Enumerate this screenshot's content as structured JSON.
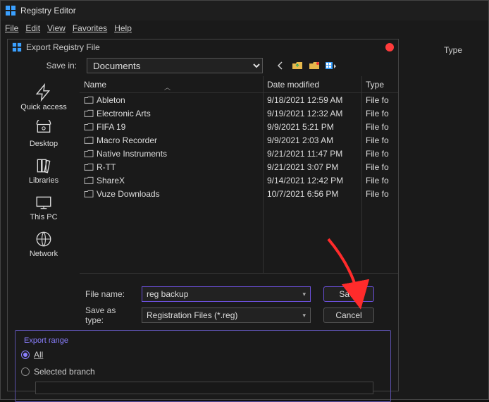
{
  "app": {
    "title": "Registry Editor",
    "menus": [
      "File",
      "Edit",
      "View",
      "Favorites",
      "Help"
    ]
  },
  "bg": {
    "col_type": "Type"
  },
  "dialog": {
    "title": "Export Registry File",
    "save_in_label": "Save in:",
    "save_in_value": "Documents",
    "nav_icons": [
      "back",
      "up-folder",
      "new-folder",
      "views"
    ],
    "places": [
      {
        "id": "quick-access",
        "label": "Quick access"
      },
      {
        "id": "desktop",
        "label": "Desktop"
      },
      {
        "id": "libraries",
        "label": "Libraries"
      },
      {
        "id": "this-pc",
        "label": "This PC"
      },
      {
        "id": "network",
        "label": "Network"
      }
    ],
    "columns": {
      "name": "Name",
      "date": "Date modified",
      "type": "Type"
    },
    "rows": [
      {
        "name": "Ableton",
        "date": "9/18/2021 12:59 AM",
        "type": "File fo"
      },
      {
        "name": "Electronic Arts",
        "date": "9/19/2021 12:32 AM",
        "type": "File fo"
      },
      {
        "name": "FIFA 19",
        "date": "9/9/2021 5:21 PM",
        "type": "File fo"
      },
      {
        "name": "Macro Recorder",
        "date": "9/9/2021 2:03 AM",
        "type": "File fo"
      },
      {
        "name": "Native Instruments",
        "date": "9/21/2021 11:47 PM",
        "type": "File fo"
      },
      {
        "name": "R-TT",
        "date": "9/21/2021 3:07 PM",
        "type": "File fo"
      },
      {
        "name": "ShareX",
        "date": "9/14/2021 12:42 PM",
        "type": "File fo"
      },
      {
        "name": "Vuze Downloads",
        "date": "10/7/2021 6:56 PM",
        "type": "File fo"
      }
    ],
    "file_name_label": "File name:",
    "file_name_value": "reg backup",
    "save_as_type_label": "Save as type:",
    "save_as_type_value": "Registration Files (*.reg)",
    "save_button": "Save",
    "cancel_button": "Cancel",
    "export_range": {
      "legend": "Export range",
      "all_label": "All",
      "selected_label": "Selected branch",
      "selected_value": ""
    }
  }
}
